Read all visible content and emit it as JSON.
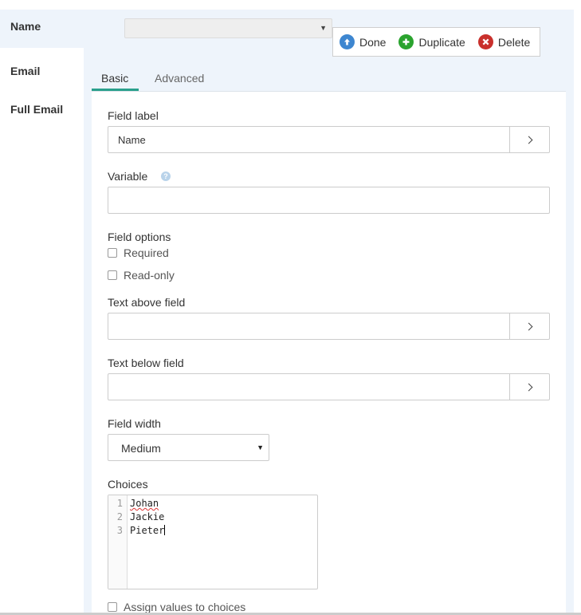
{
  "sidebar": {
    "items": [
      {
        "label": "Name"
      },
      {
        "label": "Email"
      },
      {
        "label": "Full Email"
      }
    ]
  },
  "field_type_select": {
    "value": ""
  },
  "toolbar": {
    "done_label": "Done",
    "duplicate_label": "Duplicate",
    "delete_label": "Delete"
  },
  "tabs": [
    {
      "label": "Basic"
    },
    {
      "label": "Advanced"
    }
  ],
  "form": {
    "field_label": {
      "label": "Field label",
      "value": "Name"
    },
    "variable": {
      "label": "Variable",
      "value": ""
    },
    "field_options": {
      "label": "Field options",
      "required_label": "Required",
      "readonly_label": "Read-only"
    },
    "text_above": {
      "label": "Text above field",
      "value": ""
    },
    "text_below": {
      "label": "Text below field",
      "value": ""
    },
    "field_width": {
      "label": "Field width",
      "value": "Medium"
    },
    "choices": {
      "label": "Choices",
      "lines": [
        {
          "num": "1",
          "text": "Johan"
        },
        {
          "num": "2",
          "text": "Jackie"
        },
        {
          "num": "3",
          "text": "Pieter"
        }
      ]
    },
    "assign_values_label": "Assign values to choices"
  },
  "colors": {
    "accent": "#2aa08c",
    "panel_bg": "#eef4fb",
    "done_icon": "#3d86d0",
    "duplicate_icon": "#2aa32e",
    "delete_icon": "#c9302c"
  },
  "icons": {
    "done": "arrow-up-circle-icon",
    "duplicate": "plus-circle-icon",
    "delete": "x-circle-icon",
    "help": "question-circle-icon",
    "expand": "chevron-right-icon"
  }
}
